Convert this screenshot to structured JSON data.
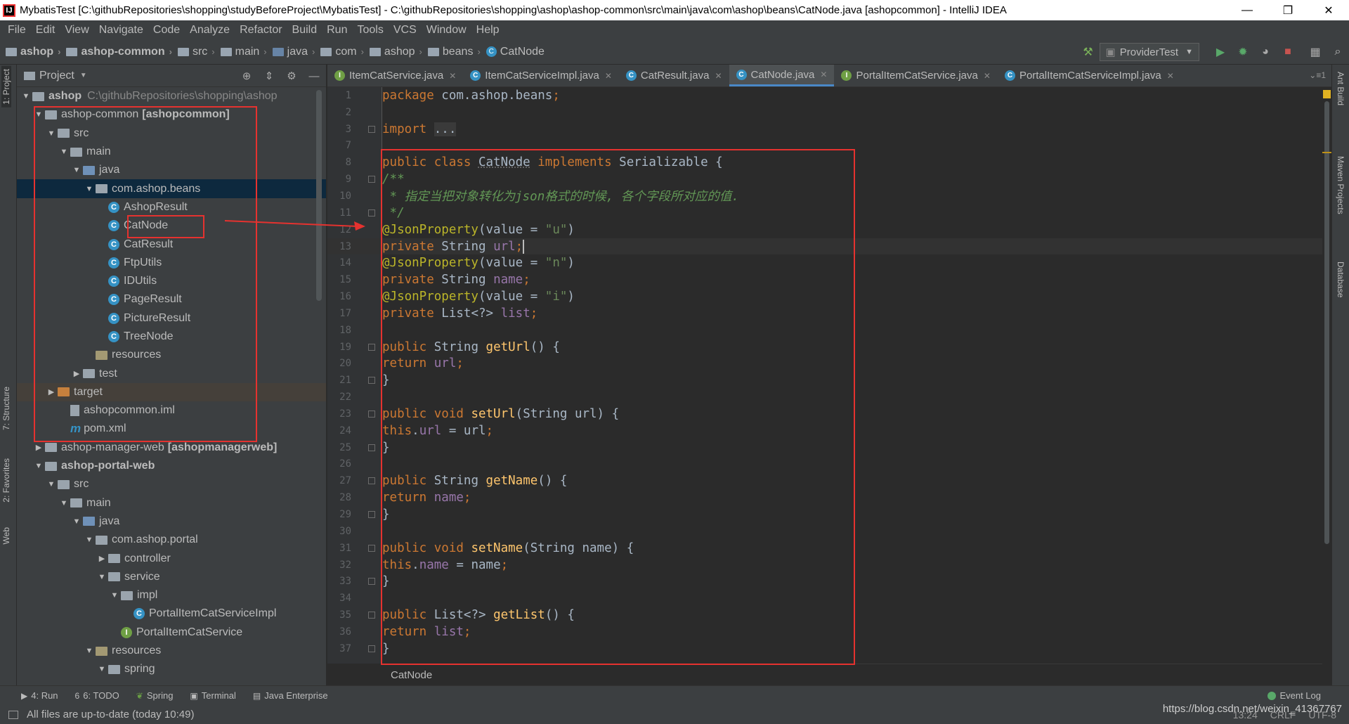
{
  "window": {
    "title": "MybatisTest [C:\\githubRepositories\\shopping\\studyBeforeProject\\MybatisTest] - C:\\githubRepositories\\shopping\\ashop\\ashop-common\\src\\main\\java\\com\\ashop\\beans\\CatNode.java [ashopcommon] - IntelliJ IDEA",
    "minimize": "—",
    "restore": "❐",
    "close": "✕"
  },
  "menu": [
    "File",
    "Edit",
    "View",
    "Navigate",
    "Code",
    "Analyze",
    "Refactor",
    "Build",
    "Run",
    "Tools",
    "VCS",
    "Window",
    "Help"
  ],
  "breadcrumbs": [
    "ashop",
    "ashop-common",
    "src",
    "main",
    "java",
    "com",
    "ashop",
    "beans",
    "CatNode"
  ],
  "run_config": "ProviderTest",
  "project_panel": {
    "title": "Project",
    "rows": [
      {
        "label": "ashop",
        "path": "C:\\githubRepositories\\shopping\\ashop"
      },
      {
        "label": "ashop-common",
        "module": "[ashopcommon]"
      },
      {
        "label": "src"
      },
      {
        "label": "main"
      },
      {
        "label": "java"
      },
      {
        "label": "com.ashop.beans"
      },
      {
        "label": "AshopResult"
      },
      {
        "label": "CatNode"
      },
      {
        "label": "CatResult"
      },
      {
        "label": "FtpUtils"
      },
      {
        "label": "IDUtils"
      },
      {
        "label": "PageResult"
      },
      {
        "label": "PictureResult"
      },
      {
        "label": "TreeNode"
      },
      {
        "label": "resources"
      },
      {
        "label": "test"
      },
      {
        "label": "target"
      },
      {
        "label": "ashopcommon.iml"
      },
      {
        "label": "pom.xml"
      },
      {
        "label": "ashop-manager-web",
        "module": "[ashopmanagerweb]"
      },
      {
        "label": "ashop-portal-web"
      },
      {
        "label": "src"
      },
      {
        "label": "main"
      },
      {
        "label": "java"
      },
      {
        "label": "com.ashop.portal"
      },
      {
        "label": "controller"
      },
      {
        "label": "service"
      },
      {
        "label": "impl"
      },
      {
        "label": "PortalItemCatServiceImpl"
      },
      {
        "label": "PortalItemCatService"
      },
      {
        "label": "resources"
      },
      {
        "label": "spring"
      }
    ]
  },
  "tabs": [
    {
      "label": "ItemCatService.java",
      "kind": "I"
    },
    {
      "label": "ItemCatServiceImpl.java",
      "kind": "C"
    },
    {
      "label": "CatResult.java",
      "kind": "C"
    },
    {
      "label": "CatNode.java",
      "kind": "C",
      "active": true
    },
    {
      "label": "PortalItemCatService.java",
      "kind": "I"
    },
    {
      "label": "PortalItemCatServiceImpl.java",
      "kind": "C"
    }
  ],
  "tabs_more": "⌄≡1",
  "code_breadcrumb": "CatNode",
  "left_stripe": {
    "project": "1: Project",
    "structure": "7: Structure",
    "favorites": "2: Favorites",
    "web": "Web"
  },
  "right_stripe": {
    "ant": "Ant Build",
    "maven": "Maven Projects",
    "database": "Database"
  },
  "bottom_tools": [
    {
      "icon": "▶",
      "label": "4: Run"
    },
    {
      "icon": "6",
      "label": "6: TODO"
    },
    {
      "icon": "❦",
      "label": "Spring"
    },
    {
      "icon": "▣",
      "label": "Terminal"
    },
    {
      "icon": "▤",
      "label": "Java Enterprise"
    }
  ],
  "event_log": "Event Log",
  "status": {
    "message": "All files are up-to-date (today 10:49)",
    "position": "13:24",
    "line_sep": "CRLF",
    "encoding": "UTF-8"
  },
  "watermark": "https://blog.csdn.net/weixin_41367767",
  "colors": {
    "keyword": "#cc7832",
    "field": "#9876aa",
    "string": "#6a8759",
    "annotation": "#bbb529",
    "comment": "#629755",
    "highlight_box": "#e5322f"
  }
}
